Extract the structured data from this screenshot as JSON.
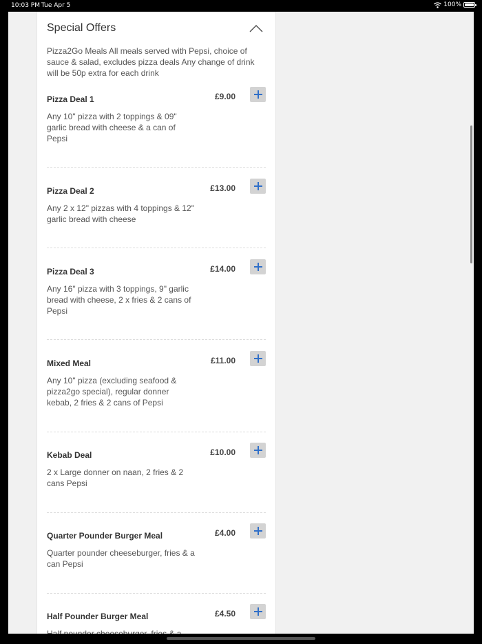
{
  "status_bar": {
    "time": "10:03 PM",
    "date": "Tue Apr 5",
    "battery": "100%"
  },
  "section": {
    "title": "Special Offers",
    "description": "Pizza2Go Meals All meals served with Pepsi, choice of sauce & salad, excludes pizza deals Any change of drink will be 50p extra for each drink"
  },
  "items": [
    {
      "name": "Pizza Deal 1",
      "price": "£9.00",
      "description": "Any 10\" pizza with 2 toppings & 09\" garlic bread with cheese & a can of Pepsi"
    },
    {
      "name": "Pizza Deal 2",
      "price": "£13.00",
      "description": "Any 2 x 12\" pizzas with 4 toppings & 12\" garlic bread with cheese"
    },
    {
      "name": "Pizza Deal 3",
      "price": "£14.00",
      "description": "Any 16\" pizza with 3 toppings, 9\" garlic bread with cheese, 2 x fries & 2 cans of Pepsi"
    },
    {
      "name": "Mixed Meal",
      "price": "£11.00",
      "description": "Any 10\" pizza (excluding seafood & pizza2go special), regular donner kebab, 2 fries & 2 cans of Pepsi"
    },
    {
      "name": "Kebab Deal",
      "price": "£10.00",
      "description": "2 x Large donner on naan, 2 fries & 2 cans Pepsi"
    },
    {
      "name": "Quarter Pounder Burger Meal",
      "price": "£4.00",
      "description": "Quarter pounder cheeseburger, fries & a can Pepsi"
    },
    {
      "name": "Half Pounder Burger Meal",
      "price": "£4.50",
      "description": "Half pounder cheeseburger, fries & a can Pepsi"
    }
  ],
  "colors": {
    "accent": "#2f6fc9",
    "button_bg": "#d3d3d3",
    "panel_bg": "#ffffff",
    "page_bg": "#f1f1f1"
  },
  "icons": {
    "add": "plus-icon",
    "collapse": "chevron-up-icon",
    "wifi": "wifi-icon",
    "battery": "battery-icon"
  }
}
